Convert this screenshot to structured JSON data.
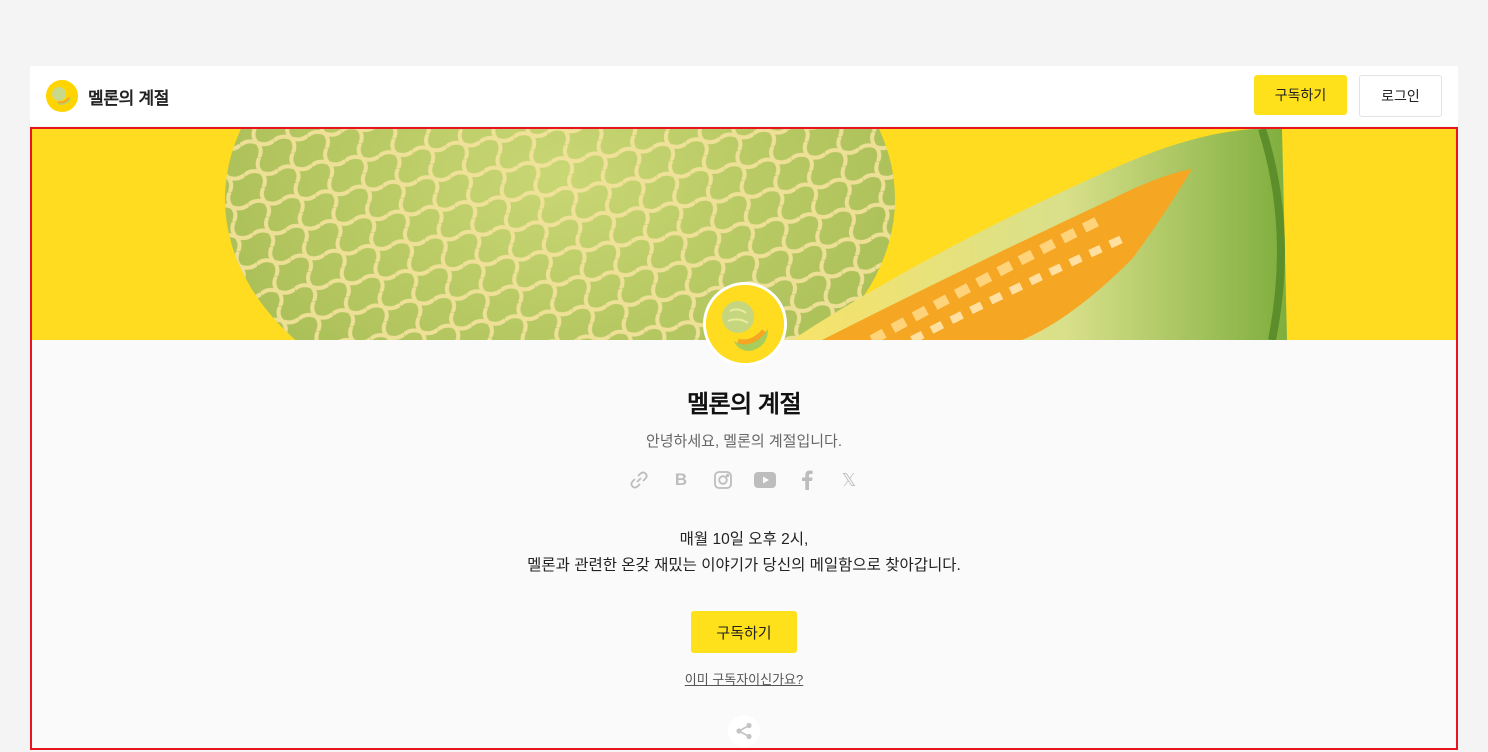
{
  "header": {
    "brand_title": "멜론의 계절",
    "subscribe_label": "구독하기",
    "login_label": "로그인"
  },
  "profile": {
    "title": "멜론의 계절",
    "description": "안녕하세요, 멜론의 계절입니다.",
    "socials": [
      {
        "name": "link-icon"
      },
      {
        "name": "blog-icon",
        "glyph": "B"
      },
      {
        "name": "instagram-icon"
      },
      {
        "name": "youtube-icon"
      },
      {
        "name": "facebook-icon"
      },
      {
        "name": "x-icon",
        "glyph": "𝕏"
      }
    ],
    "intro_line1": "매월 10일 오후 2시,",
    "intro_line2": "멜론과 관련한 온갖 재밌는 이야기가 당신의 메일함으로 찾아갑니다.",
    "subscribe_label": "구독하기",
    "already_label": "이미 구독자이신가요?"
  },
  "colors": {
    "accent": "#ffe11b",
    "cover_bg": "#ffdc1f",
    "highlight_border": "#e8141e"
  }
}
